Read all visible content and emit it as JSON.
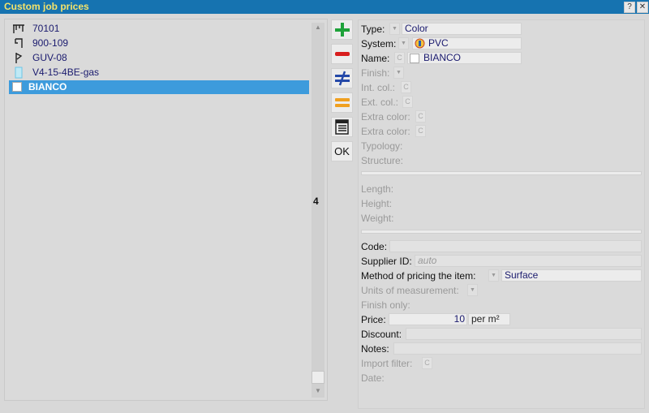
{
  "window": {
    "title": "Custom job prices",
    "help_label": "?",
    "close_label": "✕"
  },
  "list": {
    "items": [
      {
        "label": "70101",
        "icon": "profile-shape-icon"
      },
      {
        "label": "900-109",
        "icon": "profile-shape-icon"
      },
      {
        "label": "GUV-08",
        "icon": "profile-shape-icon"
      },
      {
        "label": "V4-15-4BE-gas",
        "icon": "glass-icon"
      },
      {
        "label": "BIANCO",
        "icon": "color-swatch-icon",
        "selected": true
      }
    ],
    "scroll_text": "4"
  },
  "toolbar": {
    "add_icon": "plus-icon",
    "remove_icon": "minus-icon",
    "notequal_icon": "not-equal-icon",
    "equal_icon": "equal-icon",
    "table_icon": "table-icon",
    "ok_label": "OK"
  },
  "form": {
    "type_label": "Type:",
    "type_value": "Color",
    "system_label": "System:",
    "system_value": "PVC",
    "name_label": "Name:",
    "name_c": "C",
    "name_value": "BIANCO",
    "finish_label": "Finish:",
    "intcol_label": "Int. col.:",
    "extcol_label": "Ext. col.:",
    "extra1_label": "Extra color:",
    "extra2_label": "Extra color:",
    "c_glyph": "C",
    "typology_label": "Typology:",
    "structure_label": "Structure:",
    "length_label": "Length:",
    "height_label": "Height:",
    "weight_label": "Weight:",
    "code_label": "Code:",
    "code_value": "",
    "supplier_label": "Supplier ID:",
    "supplier_placeholder": "auto",
    "method_label": "Method of pricing the item:",
    "method_value": "Surface",
    "units_label": "Units of measurement:",
    "finishonly_label": "Finish only:",
    "price_label": "Price:",
    "price_value": "10",
    "price_unit": "per m²",
    "discount_label": "Discount:",
    "notes_label": "Notes:",
    "import_label": "Import filter:",
    "date_label": "Date:"
  }
}
